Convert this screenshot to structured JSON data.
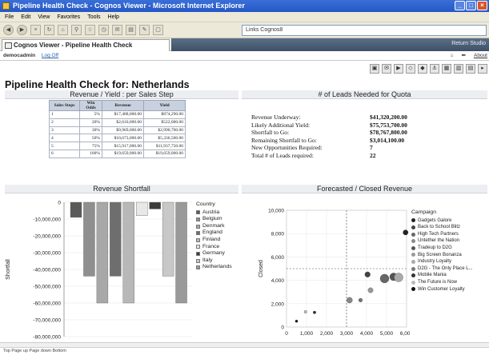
{
  "window": {
    "title": "Pipeline Health Check - Cognos Viewer - Microsoft Internet Explorer"
  },
  "menu": [
    "File",
    "Edit",
    "View",
    "Favorites",
    "Tools",
    "Help"
  ],
  "address": {
    "value": "Links  Cognos8"
  },
  "tab": {
    "label": "Cognos Viewer - Pipeline Health Check"
  },
  "tabbar_right": {
    "link": "Return Studio"
  },
  "user": {
    "name": "democadmin",
    "logoff": "Log Off"
  },
  "userbar_right": {
    "about": "About"
  },
  "page": {
    "title": "Pipeline Health Check for:  Netherlands"
  },
  "sections": {
    "revenue_yield": "Revenue / Yield : per Sales Step",
    "leads_needed": "# of Leads Needed for Quota",
    "shortfall": "Revenue Shortfall",
    "forecast": "Forecasted / Closed Revenue"
  },
  "table": {
    "headers": [
      "Sales Steps",
      "Win Odds",
      "Revenue",
      "Yield"
    ],
    "rows": [
      [
        "1",
        "5%",
        "$17,488,000.00",
        "$874,290.00"
      ],
      [
        "2",
        "20%",
        "$2,610,000.00",
        "$522,000.00"
      ],
      [
        "3",
        "30%",
        "$9,969,000.00",
        "$2,990,700.00"
      ],
      [
        "4",
        "50%",
        "$10,673,000.00",
        "$5,336,500.00"
      ],
      [
        "5",
        "75%",
        "$15,917,000.00",
        "$11,937,750.00"
      ],
      [
        "6",
        "100%",
        "$19,659,000.00",
        "$19,659,000.00"
      ]
    ]
  },
  "leads": [
    {
      "label": "Revenue Underway:",
      "value": "$41,320,200.00"
    },
    {
      "label": "Likely Additional Yield:",
      "value": "$75,753,700.00"
    },
    {
      "label": "Shortfall to Go:",
      "value": "$78,767,800.00"
    },
    {
      "label": "Remaining Shortfall to Go:",
      "value": "$3,014,100.00"
    },
    {
      "label": "New Opportunities Required:",
      "value": "7"
    },
    {
      "label": "Total # of Leads required:",
      "value": "22"
    }
  ],
  "chart_data": [
    {
      "type": "bar",
      "title": "Revenue Shortfall",
      "xlabel": "",
      "ylabel": "Shortfall",
      "ylim": [
        -80000000,
        0
      ],
      "yticks": [
        "0",
        "-10,000,000",
        "-20,000,000",
        "-30,000,000",
        "-40,000,000",
        "-50,000,000",
        "-60,000,000",
        "-70,000,000",
        "-80,000,000"
      ],
      "legend_title": "Country",
      "legend_position": "right",
      "series": [
        {
          "name": "Austria",
          "color": "#5a5a5a",
          "values": [
            -9000000
          ]
        },
        {
          "name": "Belgium",
          "color": "#8f8f8f",
          "values": [
            -44000000
          ]
        },
        {
          "name": "Denmark",
          "color": "#a8a8a8",
          "values": [
            -60000000
          ]
        },
        {
          "name": "England",
          "color": "#6e6e6e",
          "values": [
            -44000000
          ]
        },
        {
          "name": "Finland",
          "color": "#b8b8b8",
          "values": [
            -60000000
          ]
        },
        {
          "name": "France",
          "color": "#e8e8e8",
          "values": [
            -8000000
          ]
        },
        {
          "name": "Germany",
          "color": "#3c3c3c",
          "values": [
            -4000000
          ]
        },
        {
          "name": "Italy",
          "color": "#c8c8c8",
          "values": [
            -44000000
          ]
        },
        {
          "name": "Netherlands",
          "color": "#9a9a9a",
          "values": [
            -60000000
          ]
        }
      ]
    },
    {
      "type": "scatter",
      "title": "Forecasted / Closed Revenue",
      "xlabel": "",
      "ylabel": "Closed",
      "xlim": [
        0,
        6000
      ],
      "ylim": [
        0,
        10000
      ],
      "xticks": [
        "0",
        "1,000",
        "2,000",
        "3,000",
        "4,000",
        "5,000",
        "6,000"
      ],
      "yticks": [
        "0",
        "2,000",
        "4,000",
        "6,000",
        "8,000",
        "10,000"
      ],
      "legend_title": "Campaign",
      "legend_position": "right",
      "series": [
        {
          "name": "Gadgets Galore",
          "color": "#222222",
          "points": [
            [
              5950,
              8100
            ]
          ]
        },
        {
          "name": "Back to School Blitz",
          "color": "#444444",
          "points": [
            [
              4050,
              4500
            ]
          ]
        },
        {
          "name": "High Tech Partners",
          "color": "#666666",
          "points": [
            [
              4900,
              4150
            ]
          ]
        },
        {
          "name": "Untether the Nation",
          "color": "#888888",
          "points": [
            [
              3150,
              2300
            ]
          ]
        },
        {
          "name": "Tradeup to D2G",
          "color": "#555555",
          "points": [
            [
              5350,
              4300
            ]
          ]
        },
        {
          "name": "Big Screen Bonanza",
          "color": "#999999",
          "points": [
            [
              4200,
              3150
            ]
          ]
        },
        {
          "name": "Industry Loyalty",
          "color": "#aaaaaa",
          "points": [
            [
              5600,
              4250
            ]
          ]
        },
        {
          "name": "D2G - The Only Place L...",
          "color": "#777777",
          "points": [
            [
              3700,
              2300
            ]
          ]
        },
        {
          "name": "Mobile Mania",
          "color": "#333333",
          "points": [
            [
              1400,
              1250
            ]
          ]
        },
        {
          "name": "The Future is Now",
          "color": "#bbbbbb",
          "points": [
            [
              950,
              1300
            ]
          ]
        },
        {
          "name": "Win Customer Loyalty",
          "color": "#111111",
          "points": [
            [
              500,
              500
            ]
          ]
        }
      ]
    }
  ],
  "status": {
    "text": "Top  Page up  Page down  Bottom"
  }
}
